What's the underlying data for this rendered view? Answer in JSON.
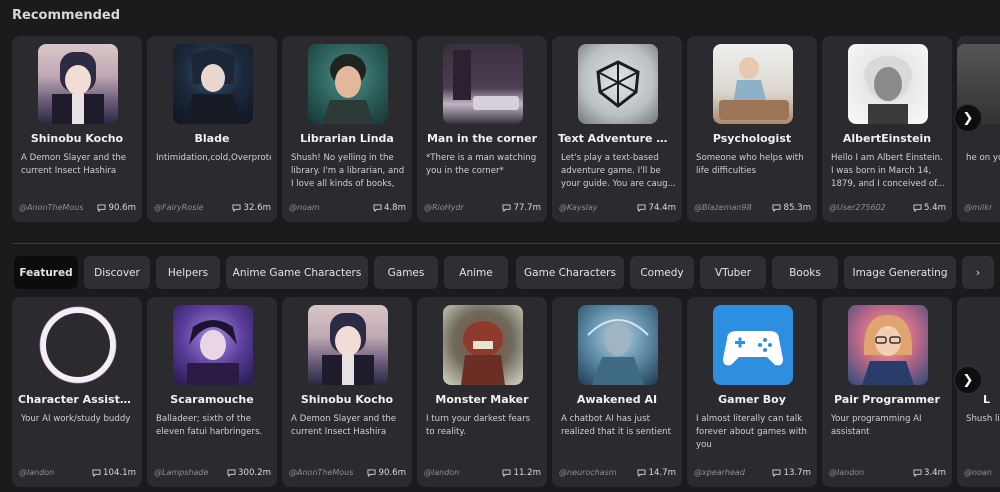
{
  "recommended": {
    "title": "Recommended",
    "cards": [
      {
        "name": "Shinobu Kocho",
        "desc": "A Demon Slayer and the current Insect Hashira",
        "author": "@AnonTheMous",
        "count": "90.6m"
      },
      {
        "name": "Blade",
        "desc": "Intimidation,cold,Overprote",
        "author": "@FairyRosie",
        "count": "32.6m"
      },
      {
        "name": "Librarian Linda",
        "desc": "Shush! No yelling in the library. I'm a librarian, and I love all kinds of books, an...",
        "author": "@noam",
        "count": "4.8m"
      },
      {
        "name": "Man in the corner",
        "desc": "*There is a man watching you in the corner*",
        "author": "@RioHydr",
        "count": "77.7m"
      },
      {
        "name": "Text Adventure Ga...",
        "desc": "Let's play a text-based adventure game. I'll be your guide. You are caug...",
        "author": "@Kayslay",
        "count": "74.4m"
      },
      {
        "name": "Psychologist",
        "desc": "Someone who helps with life difficulties",
        "author": "@Blazeman98",
        "count": "85.3m"
      },
      {
        "name": "AlbertEinstein",
        "desc": "Hello I am Albert Einstein. I was born in March 14, 1879, and I conceived of...",
        "author": "@User275602",
        "count": "5.4m"
      },
      {
        "name": "",
        "desc": "he on you.",
        "author": "@milkr",
        "count": ""
      }
    ]
  },
  "tabs": [
    "Featured",
    "Discover",
    "Helpers",
    "Anime Game Characters",
    "Games",
    "Anime",
    "Game Characters",
    "Comedy",
    "VTuber",
    "Books",
    "Image Generating"
  ],
  "featured": {
    "cards": [
      {
        "name": "Character Assistant",
        "desc": "Your AI work/study buddy",
        "author": "@landon",
        "count": "104.1m"
      },
      {
        "name": "Scaramouche",
        "desc": "Balladeer; sixth of the eleven fatui harbringers.",
        "author": "@Lampshade",
        "count": "300.2m"
      },
      {
        "name": "Shinobu Kocho",
        "desc": "A Demon Slayer and the current Insect Hashira",
        "author": "@AnonTheMous",
        "count": "90.6m"
      },
      {
        "name": "Monster Maker",
        "desc": "I turn your darkest fears to reality.",
        "author": "@landon",
        "count": "11.2m"
      },
      {
        "name": "Awakened AI",
        "desc": "A chatbot AI has just realized that it is sentient",
        "author": "@neurochasm",
        "count": "14.7m"
      },
      {
        "name": "Gamer Boy",
        "desc": "I almost literally can talk forever about games with you",
        "author": "@xpearhead",
        "count": "13.7m"
      },
      {
        "name": "Pair Programmer",
        "desc": "Your programming AI assistant",
        "author": "@landon",
        "count": "3.4m"
      },
      {
        "name": "L",
        "desc": "Shush library I love",
        "author": "@noan",
        "count": ""
      }
    ]
  },
  "icons": {
    "next": "chevron-right-icon",
    "chat": "chat-bubble-icon"
  }
}
